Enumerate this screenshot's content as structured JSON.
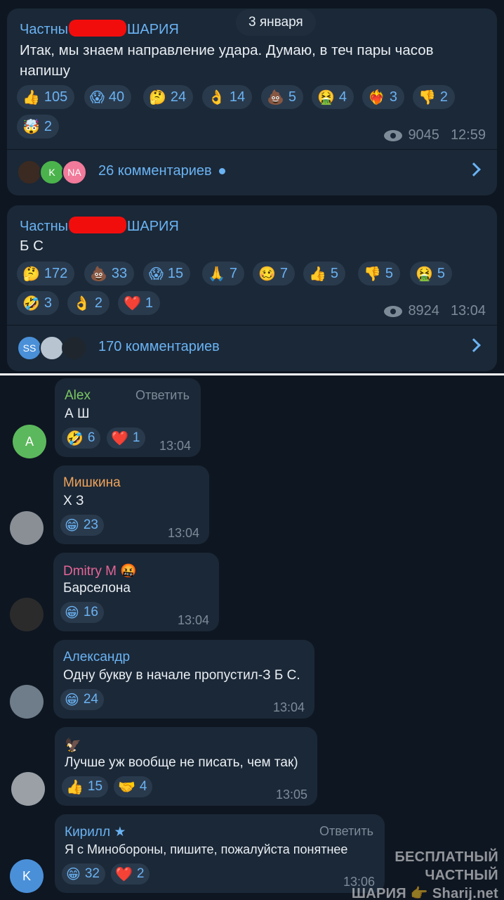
{
  "date_pill": "3 января",
  "posts": [
    {
      "author_start": "Частны",
      "author_end": "ШАРИЯ",
      "text_line1": "Итак, мы знаем направление удара. Думаю, в теч пары часов",
      "text_line2": "напишу",
      "reactions": [
        {
          "emoji": "👍",
          "count": "105"
        },
        {
          "emoji": "😱",
          "count": "40"
        },
        {
          "emoji": "🤔",
          "count": "24"
        },
        {
          "emoji": "👌",
          "count": "14"
        },
        {
          "emoji": "💩",
          "count": "5"
        },
        {
          "emoji": "🤮",
          "count": "4"
        },
        {
          "emoji": "❤️‍🔥",
          "count": "3"
        },
        {
          "emoji": "👎",
          "count": "2"
        },
        {
          "emoji": "🤯",
          "count": "2"
        }
      ],
      "views": "9045",
      "time": "12:59",
      "avatars": [
        "",
        "K",
        "NA"
      ],
      "comments": "26 комментариев"
    },
    {
      "author_start": "Частны",
      "author_end": "ШАРИЯ",
      "text_line1": "Б С",
      "reactions": [
        {
          "emoji": "🤔",
          "count": "172"
        },
        {
          "emoji": "💩",
          "count": "33"
        },
        {
          "emoji": "😱",
          "count": "15"
        },
        {
          "emoji": "🙏",
          "count": "7"
        },
        {
          "emoji": "🥴",
          "count": "7"
        },
        {
          "emoji": "👍",
          "count": "5"
        },
        {
          "emoji": "👎",
          "count": "5"
        },
        {
          "emoji": "🤮",
          "count": "5"
        },
        {
          "emoji": "🤣",
          "count": "3"
        },
        {
          "emoji": "👌",
          "count": "2"
        },
        {
          "emoji": "❤️",
          "count": "1"
        }
      ],
      "views": "8924",
      "time": "13:04",
      "avatars": [
        "SS",
        "",
        ""
      ],
      "comments": "170 комментариев"
    }
  ],
  "comments": [
    {
      "name": "Alex",
      "name_color": "#7bc862",
      "text": "А Ш",
      "reply": "Ответить",
      "time": "13:04",
      "avatar": "A",
      "reactions": [
        {
          "emoji": "🤣",
          "count": "6"
        },
        {
          "emoji": "❤️",
          "count": "1"
        }
      ]
    },
    {
      "name": "Мишкина",
      "name_color": "#f0a35a",
      "text": "Х З",
      "time": "13:04",
      "avatar": "",
      "reactions": [
        {
          "emoji": "😁",
          "count": "23"
        }
      ]
    },
    {
      "name": "Dmitry M",
      "name_emoji": "🤬",
      "name_color": "#e56597",
      "text": "Барселона",
      "time": "13:04",
      "avatar": "",
      "reactions": [
        {
          "emoji": "😁",
          "count": "16"
        }
      ]
    },
    {
      "name": "Александр",
      "name_color": "#6ab3f3",
      "text": "Одну букву в начале пропустил-З Б С.",
      "time": "13:04",
      "avatar": "",
      "reactions": [
        {
          "emoji": "😁",
          "count": "24"
        }
      ]
    },
    {
      "name": "",
      "name_emoji": "🦅",
      "text": "Лучше уж вообще не писать, чем так)",
      "time": "13:05",
      "avatar": "",
      "reactions": [
        {
          "emoji": "👍",
          "count": "15"
        },
        {
          "emoji": "🤝",
          "count": "4"
        }
      ]
    },
    {
      "name": "Кирилл",
      "name_emoji": "★",
      "name_color": "#6ab3f3",
      "text": "Я с Минобороны, пишите, пожалуйста понятнее",
      "reply": "Ответить",
      "time": "13:06",
      "avatar": "K",
      "reactions": [
        {
          "emoji": "😁",
          "count": "32"
        },
        {
          "emoji": "❤️",
          "count": "2"
        }
      ]
    }
  ],
  "watermark_line1": "БЕСПЛАТНЫЙ ЧАСТНЫЙ",
  "watermark_line2": "ШАРИЯ 👉 Sharij.net",
  "colors": {
    "bg": "#0e1621",
    "bubble": "#1b2837",
    "accent": "#6ab3f3",
    "censor": "#f20d0d"
  }
}
